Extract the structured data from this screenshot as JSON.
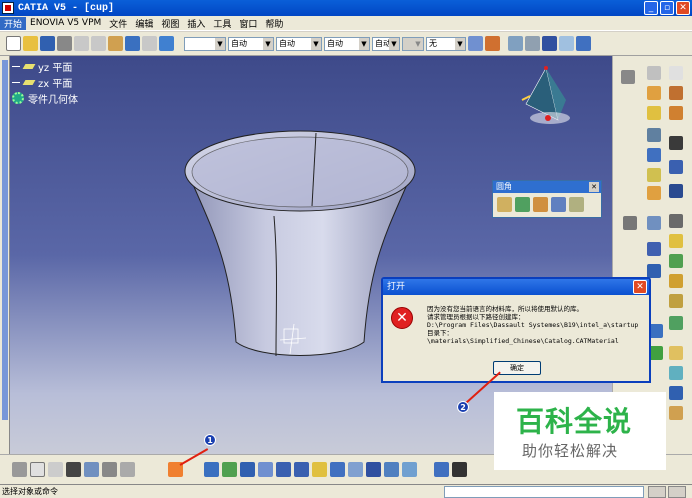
{
  "window": {
    "title": "CATIA V5 - [cup]"
  },
  "menubar": {
    "items": [
      "开始",
      "ENOVIA V5 VPM",
      "文件",
      "编辑",
      "视图",
      "插入",
      "工具",
      "窗口",
      "帮助"
    ]
  },
  "toolbar": {
    "combos": [
      {
        "value": ""
      },
      {
        "value": "自动"
      },
      {
        "value": "自动"
      },
      {
        "value": "自动"
      },
      {
        "value": "自动"
      },
      {
        "value": "无"
      }
    ]
  },
  "tree": {
    "items": [
      "yz 平面",
      "zx 平面",
      "零件几何体"
    ]
  },
  "float_toolbar": {
    "title": "圆角"
  },
  "dialog": {
    "title": "打开",
    "message": "因为没有您当前语言的材料库，所以将使用默认的库。\n请求管理员根据以下路径创建库：\nD:\\Program Files\\Dassault Systemes\\B19\\intel_a\\startup\n目录下：\n\\materials\\Simplified_Chinese\\Catalog.CATMaterial",
    "ok_label": "确定"
  },
  "callouts": {
    "one": "1",
    "two": "2"
  },
  "status": {
    "text": "选择对象或命令"
  },
  "watermark": {
    "title": "百科全说",
    "subtitle": "助你轻松解决"
  },
  "colors": {
    "accent": "#0a50d0",
    "error": "#e02020",
    "arrow": "#e02010",
    "watermark": "#2db34a"
  }
}
